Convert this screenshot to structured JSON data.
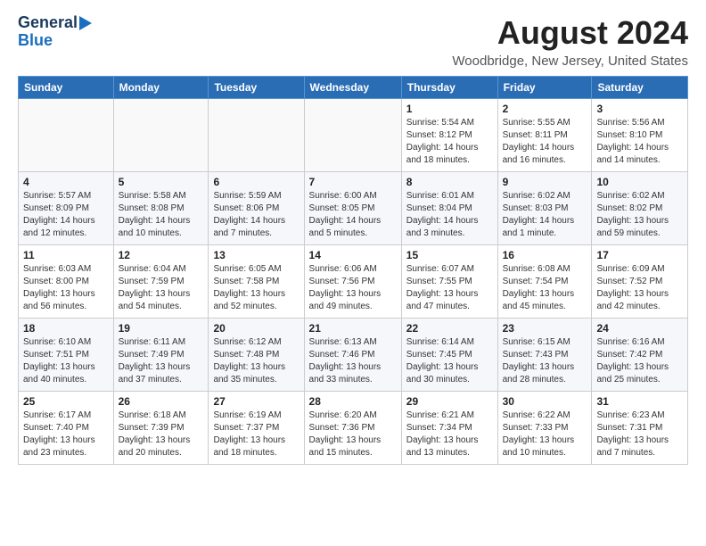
{
  "header": {
    "logo_line1": "General",
    "logo_line2": "Blue",
    "month_title": "August 2024",
    "location": "Woodbridge, New Jersey, United States"
  },
  "days_of_week": [
    "Sunday",
    "Monday",
    "Tuesday",
    "Wednesday",
    "Thursday",
    "Friday",
    "Saturday"
  ],
  "weeks": [
    [
      {
        "day": "",
        "info": ""
      },
      {
        "day": "",
        "info": ""
      },
      {
        "day": "",
        "info": ""
      },
      {
        "day": "",
        "info": ""
      },
      {
        "day": "1",
        "info": "Sunrise: 5:54 AM\nSunset: 8:12 PM\nDaylight: 14 hours\nand 18 minutes."
      },
      {
        "day": "2",
        "info": "Sunrise: 5:55 AM\nSunset: 8:11 PM\nDaylight: 14 hours\nand 16 minutes."
      },
      {
        "day": "3",
        "info": "Sunrise: 5:56 AM\nSunset: 8:10 PM\nDaylight: 14 hours\nand 14 minutes."
      }
    ],
    [
      {
        "day": "4",
        "info": "Sunrise: 5:57 AM\nSunset: 8:09 PM\nDaylight: 14 hours\nand 12 minutes."
      },
      {
        "day": "5",
        "info": "Sunrise: 5:58 AM\nSunset: 8:08 PM\nDaylight: 14 hours\nand 10 minutes."
      },
      {
        "day": "6",
        "info": "Sunrise: 5:59 AM\nSunset: 8:06 PM\nDaylight: 14 hours\nand 7 minutes."
      },
      {
        "day": "7",
        "info": "Sunrise: 6:00 AM\nSunset: 8:05 PM\nDaylight: 14 hours\nand 5 minutes."
      },
      {
        "day": "8",
        "info": "Sunrise: 6:01 AM\nSunset: 8:04 PM\nDaylight: 14 hours\nand 3 minutes."
      },
      {
        "day": "9",
        "info": "Sunrise: 6:02 AM\nSunset: 8:03 PM\nDaylight: 14 hours\nand 1 minute."
      },
      {
        "day": "10",
        "info": "Sunrise: 6:02 AM\nSunset: 8:02 PM\nDaylight: 13 hours\nand 59 minutes."
      }
    ],
    [
      {
        "day": "11",
        "info": "Sunrise: 6:03 AM\nSunset: 8:00 PM\nDaylight: 13 hours\nand 56 minutes."
      },
      {
        "day": "12",
        "info": "Sunrise: 6:04 AM\nSunset: 7:59 PM\nDaylight: 13 hours\nand 54 minutes."
      },
      {
        "day": "13",
        "info": "Sunrise: 6:05 AM\nSunset: 7:58 PM\nDaylight: 13 hours\nand 52 minutes."
      },
      {
        "day": "14",
        "info": "Sunrise: 6:06 AM\nSunset: 7:56 PM\nDaylight: 13 hours\nand 49 minutes."
      },
      {
        "day": "15",
        "info": "Sunrise: 6:07 AM\nSunset: 7:55 PM\nDaylight: 13 hours\nand 47 minutes."
      },
      {
        "day": "16",
        "info": "Sunrise: 6:08 AM\nSunset: 7:54 PM\nDaylight: 13 hours\nand 45 minutes."
      },
      {
        "day": "17",
        "info": "Sunrise: 6:09 AM\nSunset: 7:52 PM\nDaylight: 13 hours\nand 42 minutes."
      }
    ],
    [
      {
        "day": "18",
        "info": "Sunrise: 6:10 AM\nSunset: 7:51 PM\nDaylight: 13 hours\nand 40 minutes."
      },
      {
        "day": "19",
        "info": "Sunrise: 6:11 AM\nSunset: 7:49 PM\nDaylight: 13 hours\nand 37 minutes."
      },
      {
        "day": "20",
        "info": "Sunrise: 6:12 AM\nSunset: 7:48 PM\nDaylight: 13 hours\nand 35 minutes."
      },
      {
        "day": "21",
        "info": "Sunrise: 6:13 AM\nSunset: 7:46 PM\nDaylight: 13 hours\nand 33 minutes."
      },
      {
        "day": "22",
        "info": "Sunrise: 6:14 AM\nSunset: 7:45 PM\nDaylight: 13 hours\nand 30 minutes."
      },
      {
        "day": "23",
        "info": "Sunrise: 6:15 AM\nSunset: 7:43 PM\nDaylight: 13 hours\nand 28 minutes."
      },
      {
        "day": "24",
        "info": "Sunrise: 6:16 AM\nSunset: 7:42 PM\nDaylight: 13 hours\nand 25 minutes."
      }
    ],
    [
      {
        "day": "25",
        "info": "Sunrise: 6:17 AM\nSunset: 7:40 PM\nDaylight: 13 hours\nand 23 minutes."
      },
      {
        "day": "26",
        "info": "Sunrise: 6:18 AM\nSunset: 7:39 PM\nDaylight: 13 hours\nand 20 minutes."
      },
      {
        "day": "27",
        "info": "Sunrise: 6:19 AM\nSunset: 7:37 PM\nDaylight: 13 hours\nand 18 minutes."
      },
      {
        "day": "28",
        "info": "Sunrise: 6:20 AM\nSunset: 7:36 PM\nDaylight: 13 hours\nand 15 minutes."
      },
      {
        "day": "29",
        "info": "Sunrise: 6:21 AM\nSunset: 7:34 PM\nDaylight: 13 hours\nand 13 minutes."
      },
      {
        "day": "30",
        "info": "Sunrise: 6:22 AM\nSunset: 7:33 PM\nDaylight: 13 hours\nand 10 minutes."
      },
      {
        "day": "31",
        "info": "Sunrise: 6:23 AM\nSunset: 7:31 PM\nDaylight: 13 hours\nand 7 minutes."
      }
    ]
  ]
}
